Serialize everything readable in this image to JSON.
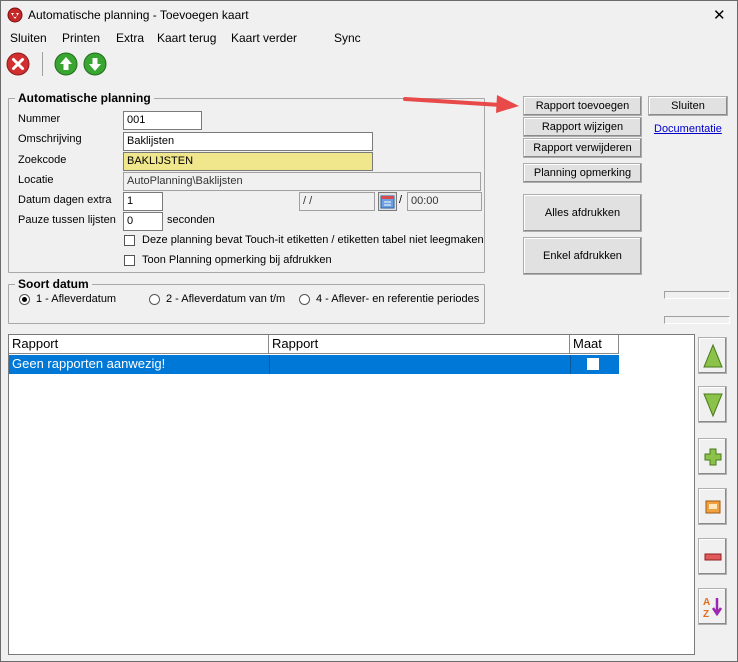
{
  "window": {
    "title": "Automatische planning - Toevoegen kaart",
    "close_glyph": "✕"
  },
  "menu": {
    "items": [
      "Sluiten",
      "Printen",
      "Extra",
      "Kaart terug",
      "Kaart verder",
      "Sync"
    ]
  },
  "colors": {
    "selection": "#0078d7",
    "highlight_field": "#f0e68c",
    "annotation_arrow": "#e84a4a",
    "green_icon": "#3aa632"
  },
  "planning": {
    "legend": "Automatische planning",
    "nummer_label": "Nummer",
    "nummer_value": "001",
    "omschrijving_label": "Omschrijving",
    "omschrijving_value": "Baklijsten",
    "zoekcode_label": "Zoekcode",
    "zoekcode_value": "BAKLIJSTEN",
    "locatie_label": "Locatie",
    "locatie_value": "AutoPlanning\\Baklijsten",
    "datum_label": "Datum dagen extra",
    "datum_value": "1",
    "date_value": "/ /",
    "time_sep": "/",
    "time_value": "00:00",
    "pauze_label": "Pauze tussen lijsten",
    "pauze_value": "0",
    "seconden_label": "seconden",
    "touchit_label": "Deze planning bevat Touch-it etiketten /  etiketten tabel niet leegmaken",
    "toon_label": "Toon Planning opmerking bij afdrukken"
  },
  "buttons": {
    "rapport_toevoegen": "Rapport toevoegen",
    "rapport_wijzigen": "Rapport wijzigen",
    "rapport_verwijderen": "Rapport verwijderen",
    "planning_opmerking": "Planning opmerking",
    "alles_afdrukken": "Alles afdrukken",
    "enkel_afdrukken": "Enkel afdrukken",
    "sluiten": "Sluiten",
    "documentatie": "Documentatie"
  },
  "soort_datum": {
    "legend": "Soort datum",
    "options": [
      "1 - Afleverdatum",
      "2 - Afleverdatum van t/m",
      "4 - Aflever- en referentie periodes"
    ],
    "selected_index": 0
  },
  "grid": {
    "columns": [
      "Rapport",
      "Rapport",
      "Maat"
    ],
    "rows": [
      {
        "rapport": "Geen rapporten aanwezig!",
        "rapport2": "",
        "maat": false
      }
    ]
  }
}
